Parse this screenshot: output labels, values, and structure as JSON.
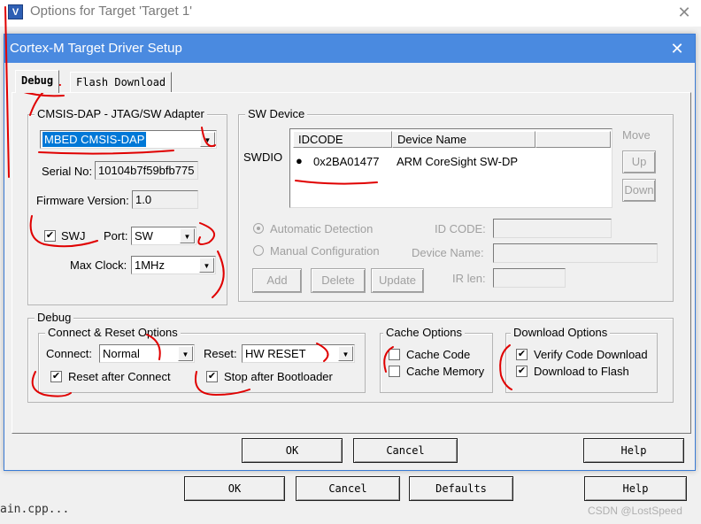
{
  "bg_window": {
    "icon_letter": "V",
    "title": "Options for Target 'Target 1'",
    "close_glyph": "✕",
    "buttons": {
      "ok": "OK",
      "cancel": "Cancel",
      "defaults": "Defaults",
      "help": "Help"
    },
    "bottom_text": "ain.cpp..."
  },
  "dialog": {
    "title": "Cortex-M Target Driver Setup",
    "close_glyph": "✕",
    "tabs": [
      {
        "label": "Debug",
        "active": true
      },
      {
        "label": "Flash Download",
        "active": false
      }
    ],
    "adapter": {
      "legend": "CMSIS-DAP - JTAG/SW Adapter",
      "selected": "MBED CMSIS-DAP",
      "serial_label": "Serial No:",
      "serial_value": "10104b7f59bfb775",
      "firmware_label": "Firmware Version:",
      "firmware_value": "1.0",
      "swj_label": "SWJ",
      "swj_checked": true,
      "port_label": "Port:",
      "port_value": "SW",
      "maxclock_label": "Max Clock:",
      "maxclock_value": "1MHz"
    },
    "sw_device": {
      "legend": "SW Device",
      "swdio_label": "SWDIO",
      "columns": [
        "IDCODE",
        "Device Name"
      ],
      "rows": [
        {
          "idcode": "0x2BA01477",
          "name": "ARM CoreSight SW-DP"
        }
      ],
      "move_label": "Move",
      "up_label": "Up",
      "down_label": "Down",
      "auto_detect_label": "Automatic Detection",
      "manual_config_label": "Manual Configuration",
      "idcode_label": "ID CODE:",
      "device_name_label": "Device Name:",
      "ir_len_label": "IR len:",
      "add_label": "Add",
      "delete_label": "Delete",
      "update_label": "Update"
    },
    "debug": {
      "legend": "Debug",
      "connect_reset": {
        "legend": "Connect & Reset Options",
        "connect_label": "Connect:",
        "connect_value": "Normal",
        "reset_label": "Reset:",
        "reset_value": "HW RESET",
        "reset_after_connect_label": "Reset after Connect",
        "reset_after_connect_checked": true,
        "stop_after_bootloader_label": "Stop after Bootloader",
        "stop_after_bootloader_checked": true
      },
      "cache": {
        "legend": "Cache Options",
        "cache_code_label": "Cache Code",
        "cache_code_checked": false,
        "cache_memory_label": "Cache Memory",
        "cache_memory_checked": false
      },
      "download": {
        "legend": "Download Options",
        "verify_label": "Verify Code Download",
        "verify_checked": true,
        "download_flash_label": "Download to Flash",
        "download_flash_checked": true
      }
    },
    "buttons": {
      "ok": "OK",
      "cancel": "Cancel",
      "help": "Help"
    }
  },
  "watermark": "CSDN @LostSpeed",
  "colors": {
    "title_bar": "#4a8ae0",
    "selection": "#0078d7",
    "annotation": "#e00000"
  },
  "icons": {
    "check": "✔",
    "combo_arrow": "▼",
    "radio_selected": "●"
  }
}
